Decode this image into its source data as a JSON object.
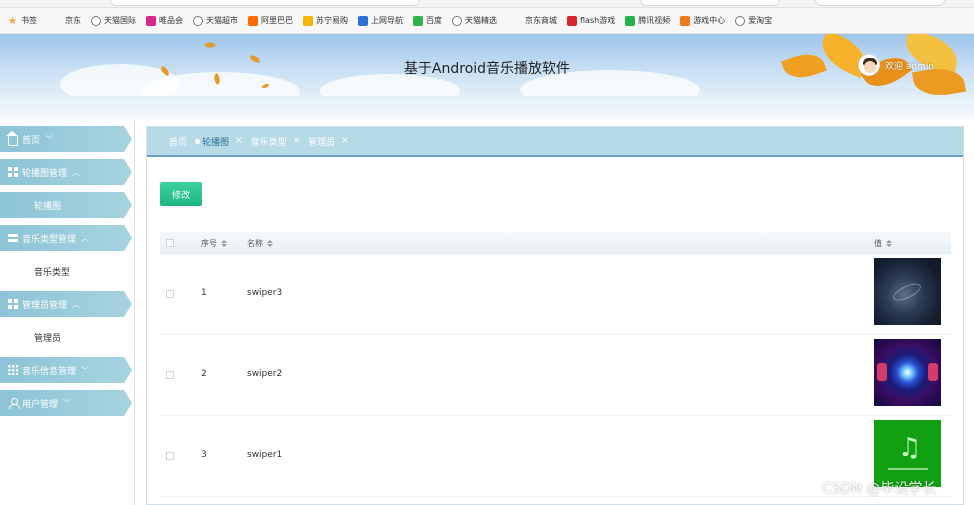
{
  "bookmarks": [
    {
      "label": "书签",
      "icon": "star-icon",
      "color": "#f2a33a"
    },
    {
      "label": "京东",
      "icon": "bookmark-icon",
      "color": "#ffffff"
    },
    {
      "label": "天猫国际",
      "icon": "globe-icon",
      "color": "#777777"
    },
    {
      "label": "唯品会",
      "icon": "vip-icon",
      "color": "#d9258e"
    },
    {
      "label": "天猫超市",
      "icon": "globe-icon",
      "color": "#777777"
    },
    {
      "label": "阿里巴巴",
      "icon": "alibaba-icon",
      "color": "#ff6a00"
    },
    {
      "label": "苏宁易购",
      "icon": "suning-icon",
      "color": "#f5b400"
    },
    {
      "label": "上网导航",
      "icon": "navigation-icon",
      "color": "#2c6fd6"
    },
    {
      "label": "百度",
      "icon": "baidu-icon",
      "color": "#2bb54a"
    },
    {
      "label": "天猫精选",
      "icon": "globe-icon",
      "color": "#777777"
    },
    {
      "label": "京东商城",
      "icon": "bookmark-icon",
      "color": "#ffffff"
    },
    {
      "label": "flash游戏",
      "icon": "flash-icon",
      "color": "#d6262b"
    },
    {
      "label": "腾讯视频",
      "icon": "video-icon",
      "color": "#27b24a"
    },
    {
      "label": "游戏中心",
      "icon": "gamepad-icon",
      "color": "#f07b1a"
    },
    {
      "label": "爱淘宝",
      "icon": "globe-icon",
      "color": "#777777"
    }
  ],
  "header": {
    "title": "基于Android音乐播放软件",
    "welcome": "欢迎 admin"
  },
  "sidebar": {
    "items": [
      {
        "label": "首页",
        "type": "head",
        "icon": "home-icon",
        "chevron": "﹀"
      },
      {
        "label": "轮播图管理",
        "type": "head",
        "icon": "grid-icon",
        "chevron": "︿"
      },
      {
        "label": "轮播图",
        "type": "sub",
        "active": true
      },
      {
        "label": "音乐类型管理",
        "type": "head",
        "icon": "list-icon",
        "chevron": "︿"
      },
      {
        "label": "音乐类型",
        "type": "sub",
        "active": false
      },
      {
        "label": "管理员管理",
        "type": "head",
        "icon": "grid-icon",
        "chevron": "︿"
      },
      {
        "label": "管理员",
        "type": "sub",
        "active": false
      },
      {
        "label": "音乐信息管理",
        "type": "head",
        "icon": "apps-icon",
        "chevron": "﹀"
      },
      {
        "label": "用户管理",
        "type": "head",
        "icon": "user-icon",
        "chevron": "﹀"
      }
    ]
  },
  "tabs": [
    {
      "label": "首页",
      "active": false,
      "closable": false
    },
    {
      "label": "轮播图",
      "active": true,
      "closable": true
    },
    {
      "label": "音乐类型",
      "active": false,
      "closable": true
    },
    {
      "label": "管理员",
      "active": false,
      "closable": true
    }
  ],
  "toolbar": {
    "edit_label": "修改"
  },
  "table": {
    "columns": [
      "序号",
      "名称",
      "值"
    ],
    "rows": [
      {
        "index": "1",
        "name": "swiper3",
        "image": "dark-blue-abstract"
      },
      {
        "index": "2",
        "name": "swiper2",
        "image": "neon-kaleidoscope"
      },
      {
        "index": "3",
        "name": "swiper1",
        "image": "green-music-note"
      }
    ]
  },
  "watermark": "CSDN @毕设学长",
  "colors": {
    "accent": "#8cc4d6",
    "tab_bar": "#b7dbe6",
    "tab_underline": "#5e9fc4",
    "edit_button": "#1fb585"
  }
}
